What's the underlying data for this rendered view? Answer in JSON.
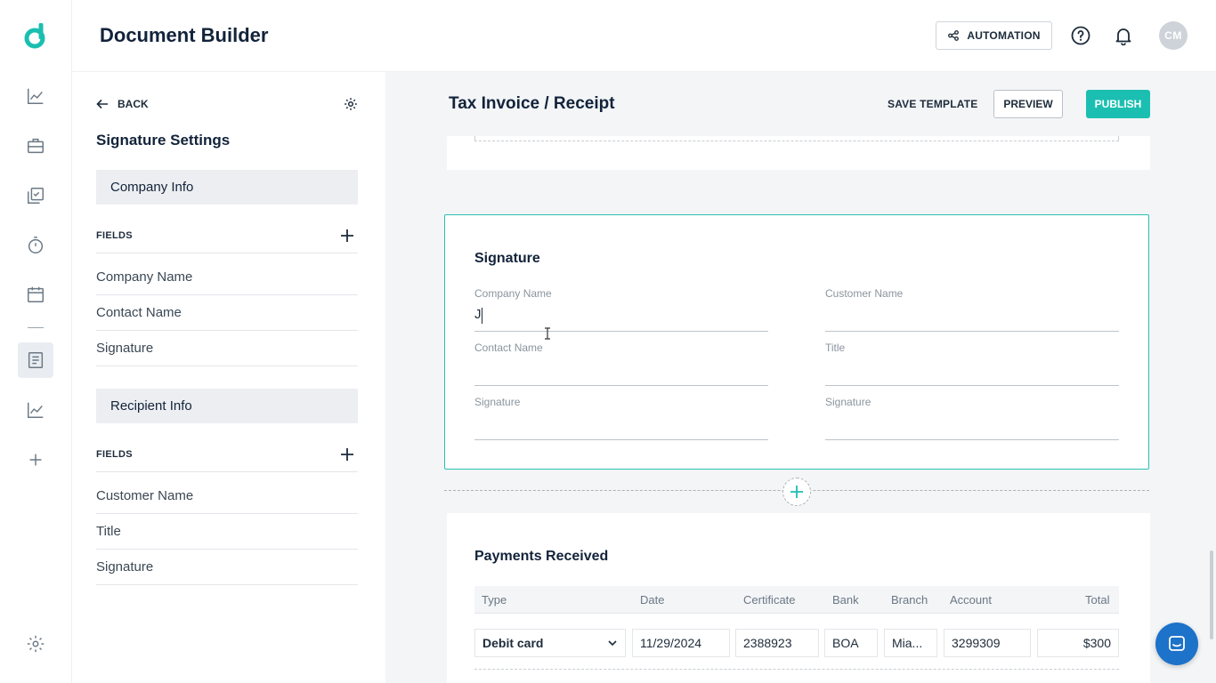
{
  "app": {
    "title": "Document Builder",
    "brand_color": "#1bbfb1"
  },
  "header": {
    "automation_label": "AUTOMATION",
    "avatar_initials": "CM"
  },
  "sidebar_icons": [
    "chart-line-icon",
    "briefcase-icon",
    "checklist-icon",
    "stopwatch-icon",
    "calendar-icon",
    "document-icon",
    "analytics-icon",
    "plus-icon",
    "settings-icon"
  ],
  "panel": {
    "back_label": "BACK",
    "title": "Signature Settings",
    "groups": [
      {
        "name": "Company Info",
        "fields_label": "FIELDS",
        "fields": [
          "Company Name",
          "Contact Name",
          "Signature"
        ]
      },
      {
        "name": "Recipient Info",
        "fields_label": "FIELDS",
        "fields": [
          "Customer Name",
          "Title",
          "Signature"
        ]
      }
    ]
  },
  "canvas": {
    "doc_title": "Tax Invoice / Receipt",
    "save_template_label": "SAVE TEMPLATE",
    "preview_label": "PREVIEW",
    "publish_label": "PUBLISH",
    "signature_section": {
      "title": "Signature",
      "fields": [
        {
          "label": "Company Name",
          "value": "J"
        },
        {
          "label": "Customer Name",
          "value": ""
        },
        {
          "label": "Contact Name",
          "value": ""
        },
        {
          "label": "Title",
          "value": ""
        },
        {
          "label": "Signature",
          "value": ""
        },
        {
          "label": "Signature",
          "value": ""
        }
      ]
    },
    "payments": {
      "title": "Payments Received",
      "columns": [
        "Type",
        "Date",
        "Certificate",
        "Bank",
        "Branch",
        "Account",
        "Total"
      ],
      "rows": [
        {
          "type": "Debit card",
          "date": "11/29/2024",
          "certificate": "2388923",
          "bank": "BOA",
          "branch": "Mia...",
          "account": "3299309",
          "total": "$300"
        }
      ]
    }
  }
}
